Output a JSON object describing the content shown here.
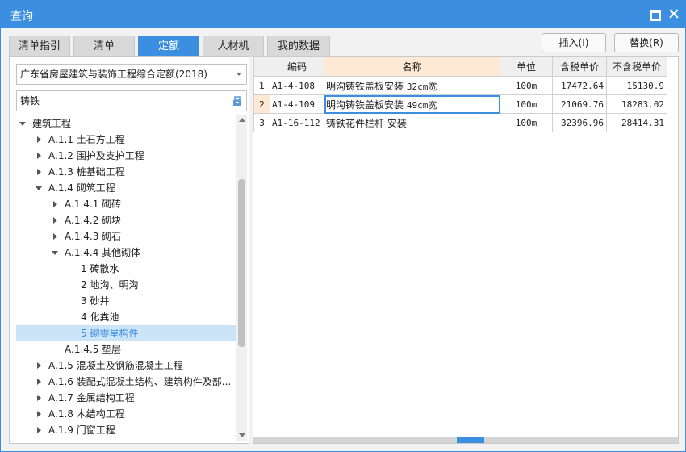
{
  "window": {
    "title": "查询"
  },
  "tabs": [
    {
      "label": "清单指引",
      "active": false
    },
    {
      "label": "清单",
      "active": false
    },
    {
      "label": "定额",
      "active": true
    },
    {
      "label": "人材机",
      "active": false
    },
    {
      "label": "我的数据",
      "active": false
    }
  ],
  "toolbar": {
    "insert_label": "插入(I)",
    "replace_label": "替换(R)"
  },
  "quota_select": {
    "value": "广东省房屋建筑与装饰工程综合定额(2018)"
  },
  "search": {
    "value": "铸铁",
    "icon": "search-icon"
  },
  "tree": [
    {
      "label": "建筑工程",
      "level": 0,
      "state": "expanded"
    },
    {
      "label": "A.1.1 土石方工程",
      "level": 1,
      "state": "collapsed"
    },
    {
      "label": "A.1.2 围护及支护工程",
      "level": 1,
      "state": "collapsed"
    },
    {
      "label": "A.1.3 桩基础工程",
      "level": 1,
      "state": "collapsed"
    },
    {
      "label": "A.1.4 砌筑工程",
      "level": 1,
      "state": "expanded"
    },
    {
      "label": "A.1.4.1 砌砖",
      "level": 2,
      "state": "collapsed"
    },
    {
      "label": "A.1.4.2 砌块",
      "level": 2,
      "state": "collapsed"
    },
    {
      "label": "A.1.4.3 砌石",
      "level": 2,
      "state": "collapsed"
    },
    {
      "label": "A.1.4.4 其他砌体",
      "level": 2,
      "state": "expanded"
    },
    {
      "label": "1 砖散水",
      "level": 3,
      "state": "leaf"
    },
    {
      "label": "2 地沟、明沟",
      "level": 3,
      "state": "leaf"
    },
    {
      "label": "3 砂井",
      "level": 3,
      "state": "leaf"
    },
    {
      "label": "4 化粪池",
      "level": 3,
      "state": "leaf"
    },
    {
      "label": "5 砌零星构件",
      "level": 3,
      "state": "leaf",
      "selected": true
    },
    {
      "label": "A.1.4.5 垫层",
      "level": 2,
      "state": "leaf"
    },
    {
      "label": "A.1.5 混凝土及钢筋混凝土工程",
      "level": 1,
      "state": "collapsed"
    },
    {
      "label": "A.1.6 装配式混凝土结构、建筑构件及部...",
      "level": 1,
      "state": "collapsed"
    },
    {
      "label": "A.1.7 金属结构工程",
      "level": 1,
      "state": "collapsed"
    },
    {
      "label": "A.1.8 木结构工程",
      "level": 1,
      "state": "collapsed"
    },
    {
      "label": "A.1.9 门窗工程",
      "level": 1,
      "state": "collapsed"
    }
  ],
  "grid": {
    "headers": {
      "code": "编码",
      "name": "名称",
      "unit": "单位",
      "price_tax": "含税单价",
      "price_notax": "不含税单价"
    },
    "rows": [
      {
        "idx": "1",
        "code": "A1-4-108",
        "name_cn": "明沟铸铁盖板安装",
        "name_spec": "32cm宽",
        "unit": "100m",
        "price_tax": "17472.64",
        "price_notax": "15130.9"
      },
      {
        "idx": "2",
        "code": "A1-4-109",
        "name_cn": "明沟铸铁盖板安装",
        "name_spec": "49cm宽",
        "unit": "100m",
        "price_tax": "21069.76",
        "price_notax": "18283.02"
      },
      {
        "idx": "3",
        "code": "A1-16-112",
        "name_cn": "铸铁花件栏杆 安装",
        "name_spec": "",
        "unit": "100m",
        "price_tax": "32396.96",
        "price_notax": "28414.31"
      }
    ]
  }
}
